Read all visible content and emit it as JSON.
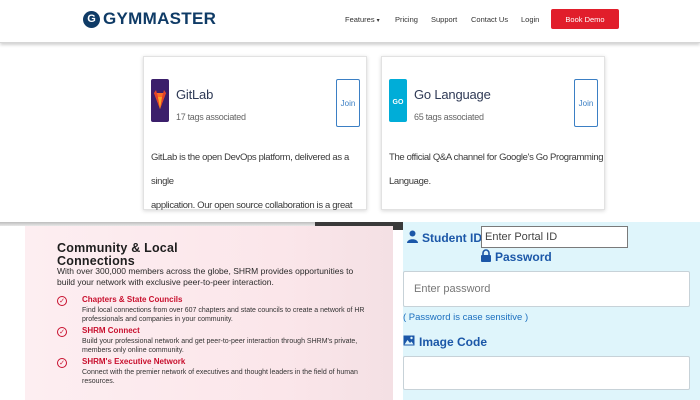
{
  "header": {
    "brand": "GYMMASTER",
    "brand_mark": "G",
    "nav": [
      {
        "label": "Features",
        "has_caret": true
      },
      {
        "label": "Pricing"
      },
      {
        "label": "Support"
      },
      {
        "label": "Contact Us"
      },
      {
        "label": "Login"
      }
    ],
    "cta": "Book Demo"
  },
  "cards": [
    {
      "title": "GitLab",
      "subtitle": "17 tags associated",
      "join": "Join",
      "description_lines": [
        "GitLab is the open DevOps platform, delivered as a single",
        "application. Our open source collaboration is a great place to sha..."
      ],
      "icon": "gitlab-fox-icon"
    },
    {
      "title": "Go Language",
      "subtitle": "65 tags associated",
      "join": "Join",
      "description_lines": [
        "The official Q&A channel for Google's Go Programming Language."
      ],
      "icon": "go-gopher-icon",
      "icon_text": "GO"
    }
  ],
  "shrm": {
    "heading_line1": "Community & Local",
    "heading_line2": "Connections",
    "intro": "With over 300,000 members across the globe, SHRM provides opportunities to build your network with exclusive peer-to-peer interaction.",
    "items": [
      {
        "title": "Chapters & State Councils",
        "desc": "Find local connections from over 607 chapters and state councils to create a network of HR professionals and companies in your community."
      },
      {
        "title": "SHRM Connect",
        "desc": "Build your professional network and get peer-to-peer interaction through SHRM's private, members only online community."
      },
      {
        "title": "SHRM's Executive Network",
        "desc": "Connect with the premier network of executives and thought leaders in the field of human resources."
      }
    ]
  },
  "login": {
    "student_id_label": "Student ID",
    "portal_placeholder": "Enter Portal ID",
    "password_label": "Password",
    "password_placeholder": "Enter password",
    "password_hint": "( Password is case sensitive )",
    "image_code_label": "Image Code"
  },
  "colors": {
    "brand_navy": "#0f3b66",
    "cta_red": "#e11e2b",
    "join_blue": "#3b7fc4",
    "login_bg": "#dff5fb",
    "label_blue": "#1b57a8",
    "shrm_red": "#c8102e"
  }
}
